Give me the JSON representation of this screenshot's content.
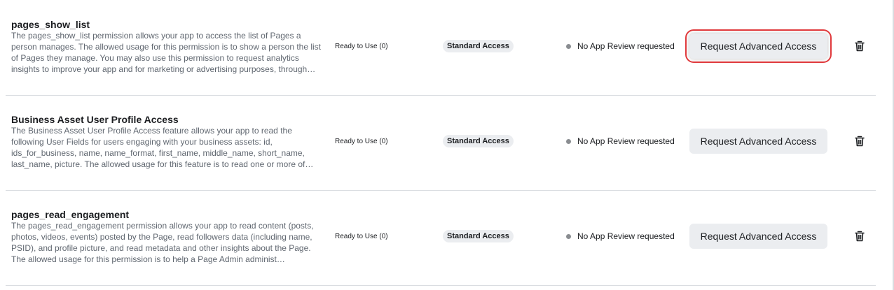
{
  "rows": [
    {
      "title": "pages_show_list",
      "description": "The pages_show_list permission allows your app to access the list of Pages a person manages. The allowed usage for this permission is to show a person the list of Pages they manage. You may also use this permission to request analytics insights to improve your app and for marketing or advertising purposes, through…",
      "ready": "Ready to Use (0)",
      "access": "Standard Access",
      "review": "No App Review requested",
      "button": "Request Advanced Access",
      "delete_icon": "trash-icon"
    },
    {
      "title": "Business Asset User Profile Access",
      "description": "The Business Asset User Profile Access feature allows your app to read the following User Fields for users engaging with your business assets: id, ids_for_business, name, name_format, first_name, middle_name, short_name, last_name, picture. The allowed usage for this feature is to read one or more of…",
      "ready": "Ready to Use (0)",
      "access": "Standard Access",
      "review": "No App Review requested",
      "button": "Request Advanced Access",
      "delete_icon": "trash-icon"
    },
    {
      "title": "pages_read_engagement",
      "description": "The pages_read_engagement permission allows your app to read content (posts, photos, videos, events) posted by the Page, read followers data (including name, PSID), and profile picture, and read metadata and other insights about the Page. The allowed usage for this permission is to help a Page Admin administ…",
      "ready": "Ready to Use (0)",
      "access": "Standard Access",
      "review": "No App Review requested",
      "button": "Request Advanced Access",
      "delete_icon": "trash-icon"
    }
  ],
  "colors": {
    "highlight": "#e0393c",
    "badge_bg": "#ebedf0",
    "dot": "#8a8d91"
  }
}
